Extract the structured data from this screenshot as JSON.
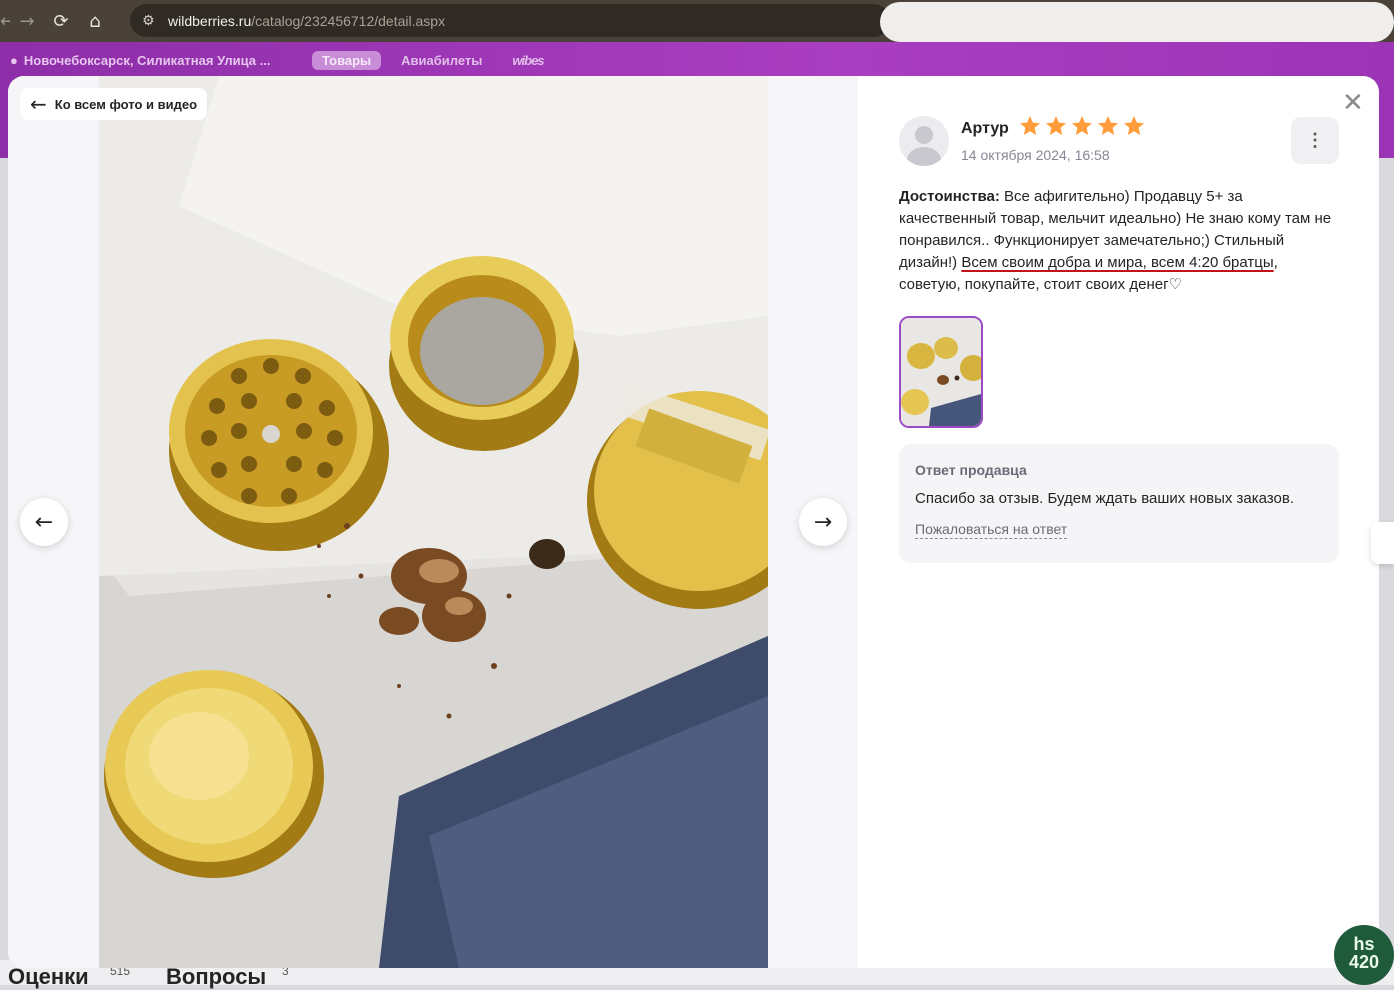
{
  "browser": {
    "back_icon": "←",
    "forward_icon": "→",
    "reload_icon": "⟳",
    "home_icon": "⌂",
    "url_domain": "wildberries.ru",
    "url_path": "/catalog/232456712/detail.aspx"
  },
  "site_header": {
    "location": "Новочебоксарск, Силикатная Улица ...",
    "tabs": [
      "Товары",
      "Авиабилеты",
      "wibes"
    ]
  },
  "page_bottom": {
    "ratings_label": "Оценки",
    "ratings_count": "515",
    "questions_label": "Вопросы",
    "questions_count": "3"
  },
  "gallery": {
    "back_label": "Ко всем фото и видео",
    "prev_icon": "←",
    "next_icon": "→"
  },
  "review": {
    "author": "Артур",
    "rating": 5,
    "date": "14 октября 2024, 16:58",
    "more_icon": "⋮",
    "close_icon": "✕",
    "text_label": "Достоинства:",
    "text_part1": " Все афигительно) Продавцу 5+ за качественный товар, мельчит идеально) Не знаю кому там не понравился.. Функционирует замечательно;) Стильный дизайн!) ",
    "text_underlined": "Всем своим добра и мира, всем 4:20 братцы",
    "text_part2": ", советую, покупайте, стоит своих денег♡",
    "star_color": "#ff9d3b"
  },
  "seller_reply": {
    "title": "Ответ продавца",
    "body": "Спасибо за отзыв. Будем ждать ваших новых заказов.",
    "report_link": "Пожаловаться на ответ"
  },
  "watermark": {
    "line1": "hs",
    "line2": "420"
  },
  "colors": {
    "accent_purple": "#9d4bc4",
    "underline_red": "#c4121a"
  }
}
